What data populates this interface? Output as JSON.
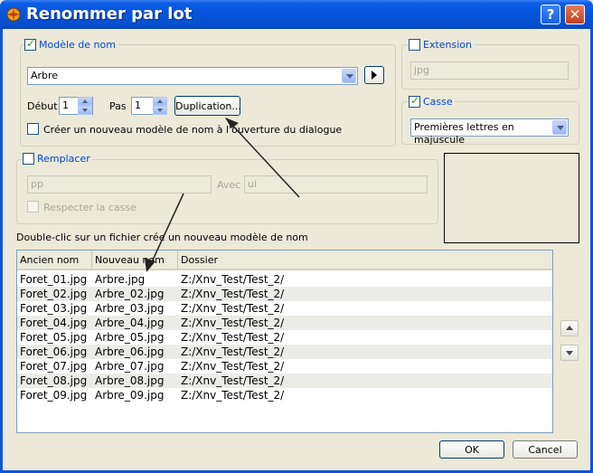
{
  "window": {
    "title": "Renommer par lot",
    "help_label": "?",
    "close_label": "✕"
  },
  "model": {
    "group_label": "Modèle de nom",
    "checked": true,
    "combo_value": "Arbre",
    "debut_label": "Début",
    "debut_value": "1",
    "pas_label": "Pas",
    "pas_value": "1",
    "duplication_label": "Duplication...",
    "create_label": "Créer un nouveau modèle de nom à l'ouverture du dialogue"
  },
  "extension": {
    "group_label": "Extension",
    "value": "jpg"
  },
  "casse": {
    "group_label": "Casse",
    "checked": true,
    "value": "Premières lettres en majuscule"
  },
  "replace": {
    "group_label": "Remplacer",
    "find_value": "pp",
    "with_label": "Avec",
    "with_value": "ui",
    "respect_label": "Respecter la casse"
  },
  "hint": "Double-clic sur un fichier crée un nouveau modèle de nom",
  "table": {
    "columns": [
      "Ancien nom",
      "Nouveau nom",
      "Dossier"
    ],
    "rows": [
      [
        "Foret_01.jpg",
        "Arbre.jpg",
        "Z:/Xnv_Test/Test_2/"
      ],
      [
        "Foret_02.jpg",
        "Arbre_02.jpg",
        "Z:/Xnv_Test/Test_2/"
      ],
      [
        "Foret_03.jpg",
        "Arbre_03.jpg",
        "Z:/Xnv_Test/Test_2/"
      ],
      [
        "Foret_04.jpg",
        "Arbre_04.jpg",
        "Z:/Xnv_Test/Test_2/"
      ],
      [
        "Foret_05.jpg",
        "Arbre_05.jpg",
        "Z:/Xnv_Test/Test_2/"
      ],
      [
        "Foret_06.jpg",
        "Arbre_06.jpg",
        "Z:/Xnv_Test/Test_2/"
      ],
      [
        "Foret_07.jpg",
        "Arbre_07.jpg",
        "Z:/Xnv_Test/Test_2/"
      ],
      [
        "Foret_08.jpg",
        "Arbre_08.jpg",
        "Z:/Xnv_Test/Test_2/"
      ],
      [
        "Foret_09.jpg",
        "Arbre_09.jpg",
        "Z:/Xnv_Test/Test_2/"
      ]
    ]
  },
  "buttons": {
    "ok": "OK",
    "cancel": "Cancel"
  }
}
